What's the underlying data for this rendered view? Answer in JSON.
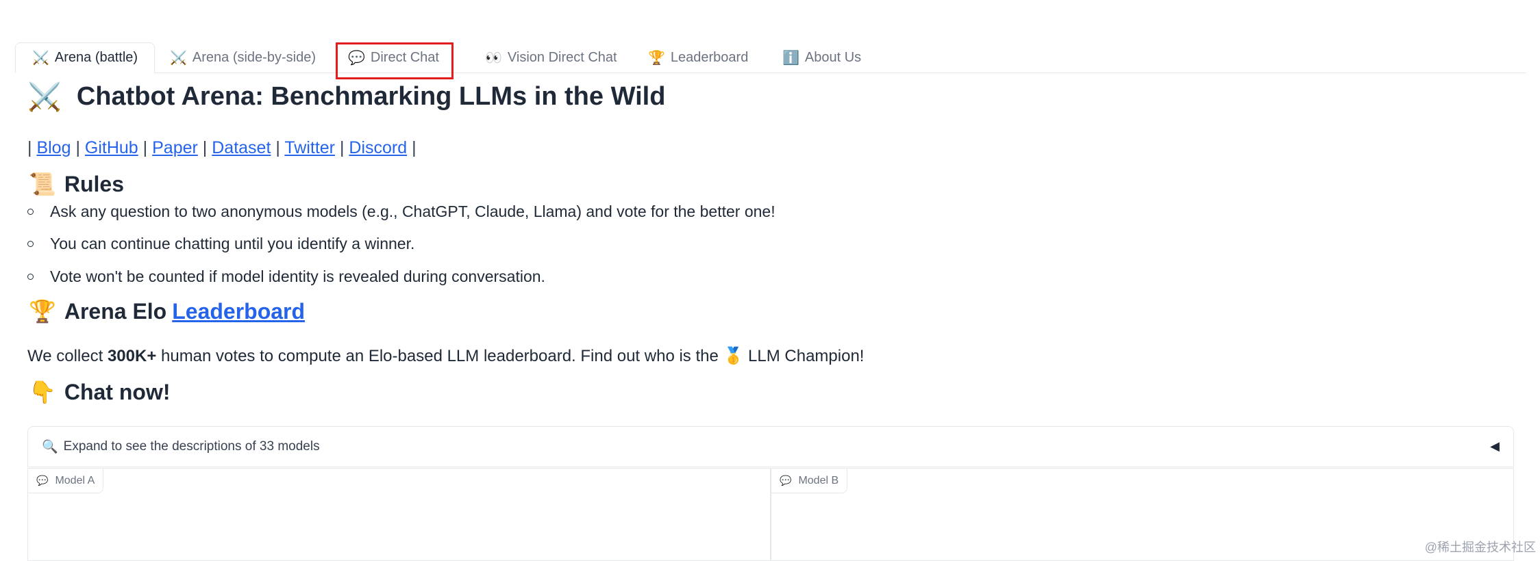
{
  "tabs": [
    {
      "icon": "⚔️",
      "label": "Arena (battle)"
    },
    {
      "icon": "⚔️",
      "label": "Arena (side-by-side)"
    },
    {
      "icon": "💬",
      "label": "Direct Chat"
    },
    {
      "icon": "👀",
      "label": "Vision Direct Chat"
    },
    {
      "icon": "🏆",
      "label": "Leaderboard"
    },
    {
      "icon": "ℹ️",
      "label": "About Us"
    }
  ],
  "header": {
    "icon": "⚔️",
    "title": "Chatbot Arena: Benchmarking LLMs in the Wild"
  },
  "links": {
    "sep": "|",
    "items": [
      "Blog",
      "GitHub",
      "Paper",
      "Dataset",
      "Twitter",
      "Discord"
    ]
  },
  "rules": {
    "icon": "📜",
    "title": "Rules",
    "items": [
      "Ask any question to two anonymous models (e.g., ChatGPT, Claude, Llama) and vote for the better one!",
      "You can continue chatting until you identify a winner.",
      "Vote won't be counted if model identity is revealed during conversation."
    ]
  },
  "elo": {
    "icon": "🏆",
    "title_prefix": "Arena Elo",
    "link": "Leaderboard"
  },
  "description": {
    "part1": "We collect ",
    "bold": "300K+",
    "part2": " human votes to compute an Elo-based LLM leaderboard. Find out who is the ",
    "medal": "🥇",
    "part3": " LLM Champion!"
  },
  "chat_now": {
    "icon": "👇",
    "title": "Chat now!"
  },
  "expand": {
    "icon": "🔍",
    "label": "Expand to see the descriptions of 33 models",
    "arrow": "◀"
  },
  "models": {
    "a_label": "Model A",
    "b_label": "Model B",
    "icon": "💬"
  },
  "watermark": "@稀土掘金技术社区"
}
